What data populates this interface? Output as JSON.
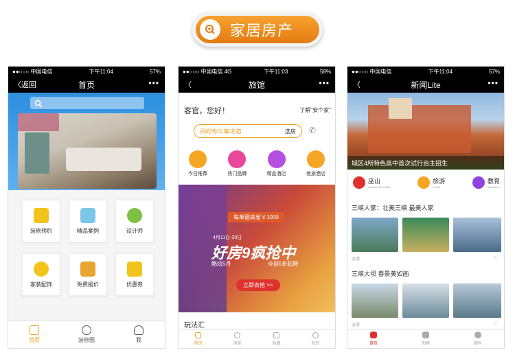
{
  "banner": {
    "title": "家居房产"
  },
  "phone1": {
    "status": {
      "carrier": "●●○○○ 中国电信",
      "time": "下午11:04",
      "battery": "57%"
    },
    "nav": {
      "back": "〈返回",
      "title": "首页",
      "more": "•••"
    },
    "grid": [
      {
        "label": "装修预约",
        "color": "#f2c31b"
      },
      {
        "label": "精品案例",
        "color": "#7ec6e8"
      },
      {
        "label": "设计师",
        "color": "#7dc043"
      },
      {
        "label": "家装配饰",
        "color": "#f2c31b"
      },
      {
        "label": "免费报价",
        "color": "#e8a531"
      },
      {
        "label": "优惠券",
        "color": "#f2c31b"
      }
    ],
    "tabs": [
      "首页",
      "装修圈",
      "我"
    ]
  },
  "phone2": {
    "status": {
      "carrier": "●●○○○ 中国电信 4G",
      "time": "下午11:03",
      "battery": "58%"
    },
    "nav": {
      "title": "旅馆",
      "more": "•••"
    },
    "greeting": "客官，您好！",
    "about": "了解\"安个家\"",
    "search": {
      "placeholder": "目的地/公寓/名宿",
      "button": "选房"
    },
    "categories": [
      {
        "label": "今日推荐",
        "color": "#f5a623"
      },
      {
        "label": "热门品牌",
        "color": "#e8479a"
      },
      {
        "label": "精品酒店",
        "color": "#b44fe0"
      },
      {
        "label": "差旅酒店",
        "color": "#f5a623"
      }
    ],
    "promo": {
      "top": "每单最高省￥1000",
      "dates": "4月11日-20日",
      "headline": "好房9疯抢中",
      "left": "酷炫5月",
      "right": "全部5折起降",
      "cta": "立即去抢 >>"
    },
    "section": "玩法汇",
    "tabs": [
      "首页",
      "消息",
      "收藏",
      "我的"
    ]
  },
  "phone3": {
    "status": {
      "carrier": "●●○○○ 中国电信",
      "time": "下午11:04",
      "battery": "57%"
    },
    "nav": {
      "title": "新闻Lite",
      "more": "•••"
    },
    "hero_caption": "城区4所特色高中首次试行自主招生",
    "cats": [
      {
        "label": "巫山",
        "sub": "Wushan Mountain",
        "color": "#e0322c"
      },
      {
        "label": "旅游",
        "sub": "Travel",
        "color": "#f5a623"
      },
      {
        "label": "教育",
        "sub": "Education",
        "color": "#8e44e0"
      }
    ],
    "article1": {
      "title": "三峡人家：壮美三峡 最美人家",
      "tag": "必游"
    },
    "article2": {
      "title": "三峡大坝 春景美如画",
      "tag": "必游"
    },
    "tabs": [
      "首页",
      "图模",
      "爆料"
    ]
  }
}
